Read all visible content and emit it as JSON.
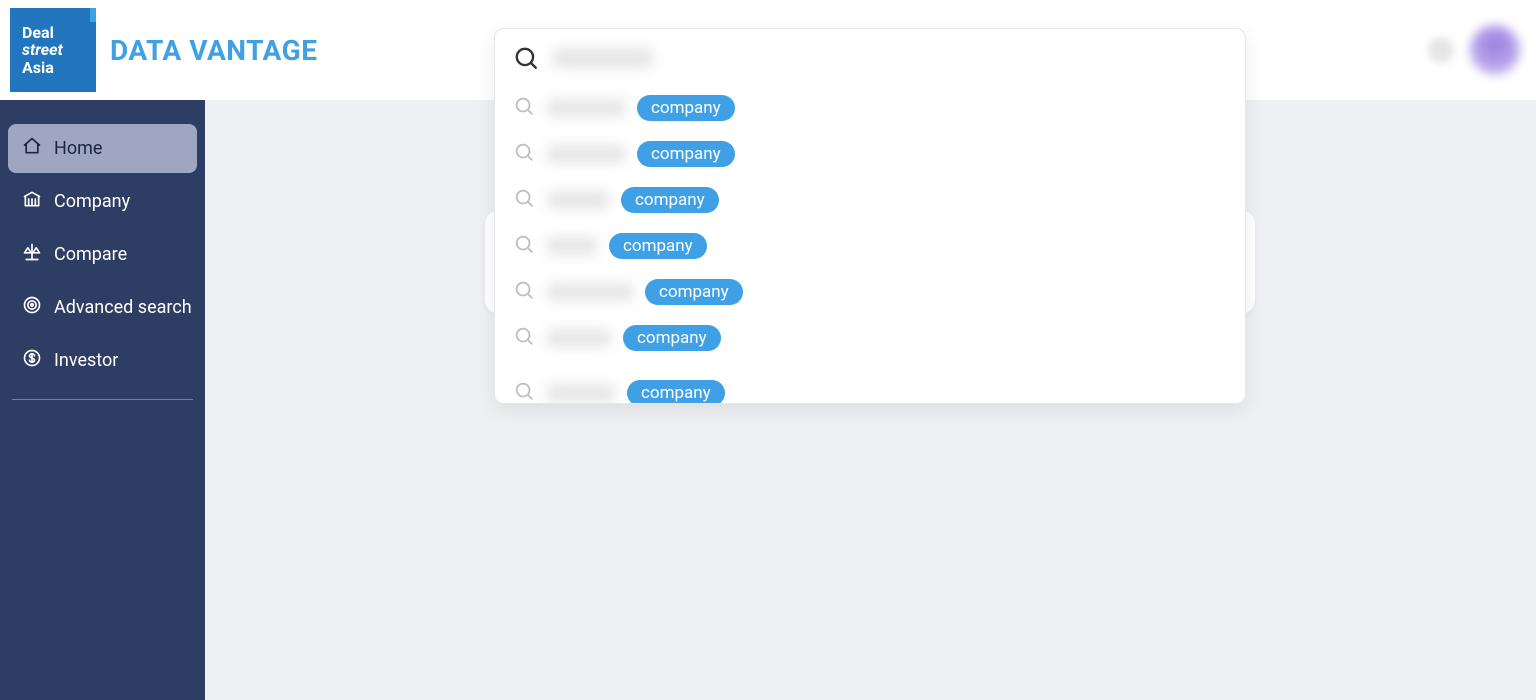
{
  "brand": {
    "logo_line1": "Deal",
    "logo_line2": "street",
    "logo_line3": "Asia",
    "title": "DATA VANTAGE"
  },
  "sidebar": {
    "items": [
      {
        "label": "Home",
        "active": true,
        "icon": "home"
      },
      {
        "label": "Company",
        "active": false,
        "icon": "bank"
      },
      {
        "label": "Compare",
        "active": false,
        "icon": "scale"
      },
      {
        "label": "Advanced search",
        "active": false,
        "icon": "target"
      },
      {
        "label": "Investor",
        "active": false,
        "icon": "dollar"
      }
    ]
  },
  "search": {
    "query_redacted": true,
    "results": [
      {
        "name_redacted": true,
        "name_width": 78,
        "tag": "company"
      },
      {
        "name_redacted": true,
        "name_width": 78,
        "tag": "company"
      },
      {
        "name_redacted": true,
        "name_width": 62,
        "tag": "company"
      },
      {
        "name_redacted": true,
        "name_width": 50,
        "tag": "company"
      },
      {
        "name_redacted": true,
        "name_width": 86,
        "tag": "company"
      },
      {
        "name_redacted": true,
        "name_width": 64,
        "tag": "company"
      },
      {
        "name_redacted": true,
        "name_width": 68,
        "tag": "company"
      }
    ]
  }
}
